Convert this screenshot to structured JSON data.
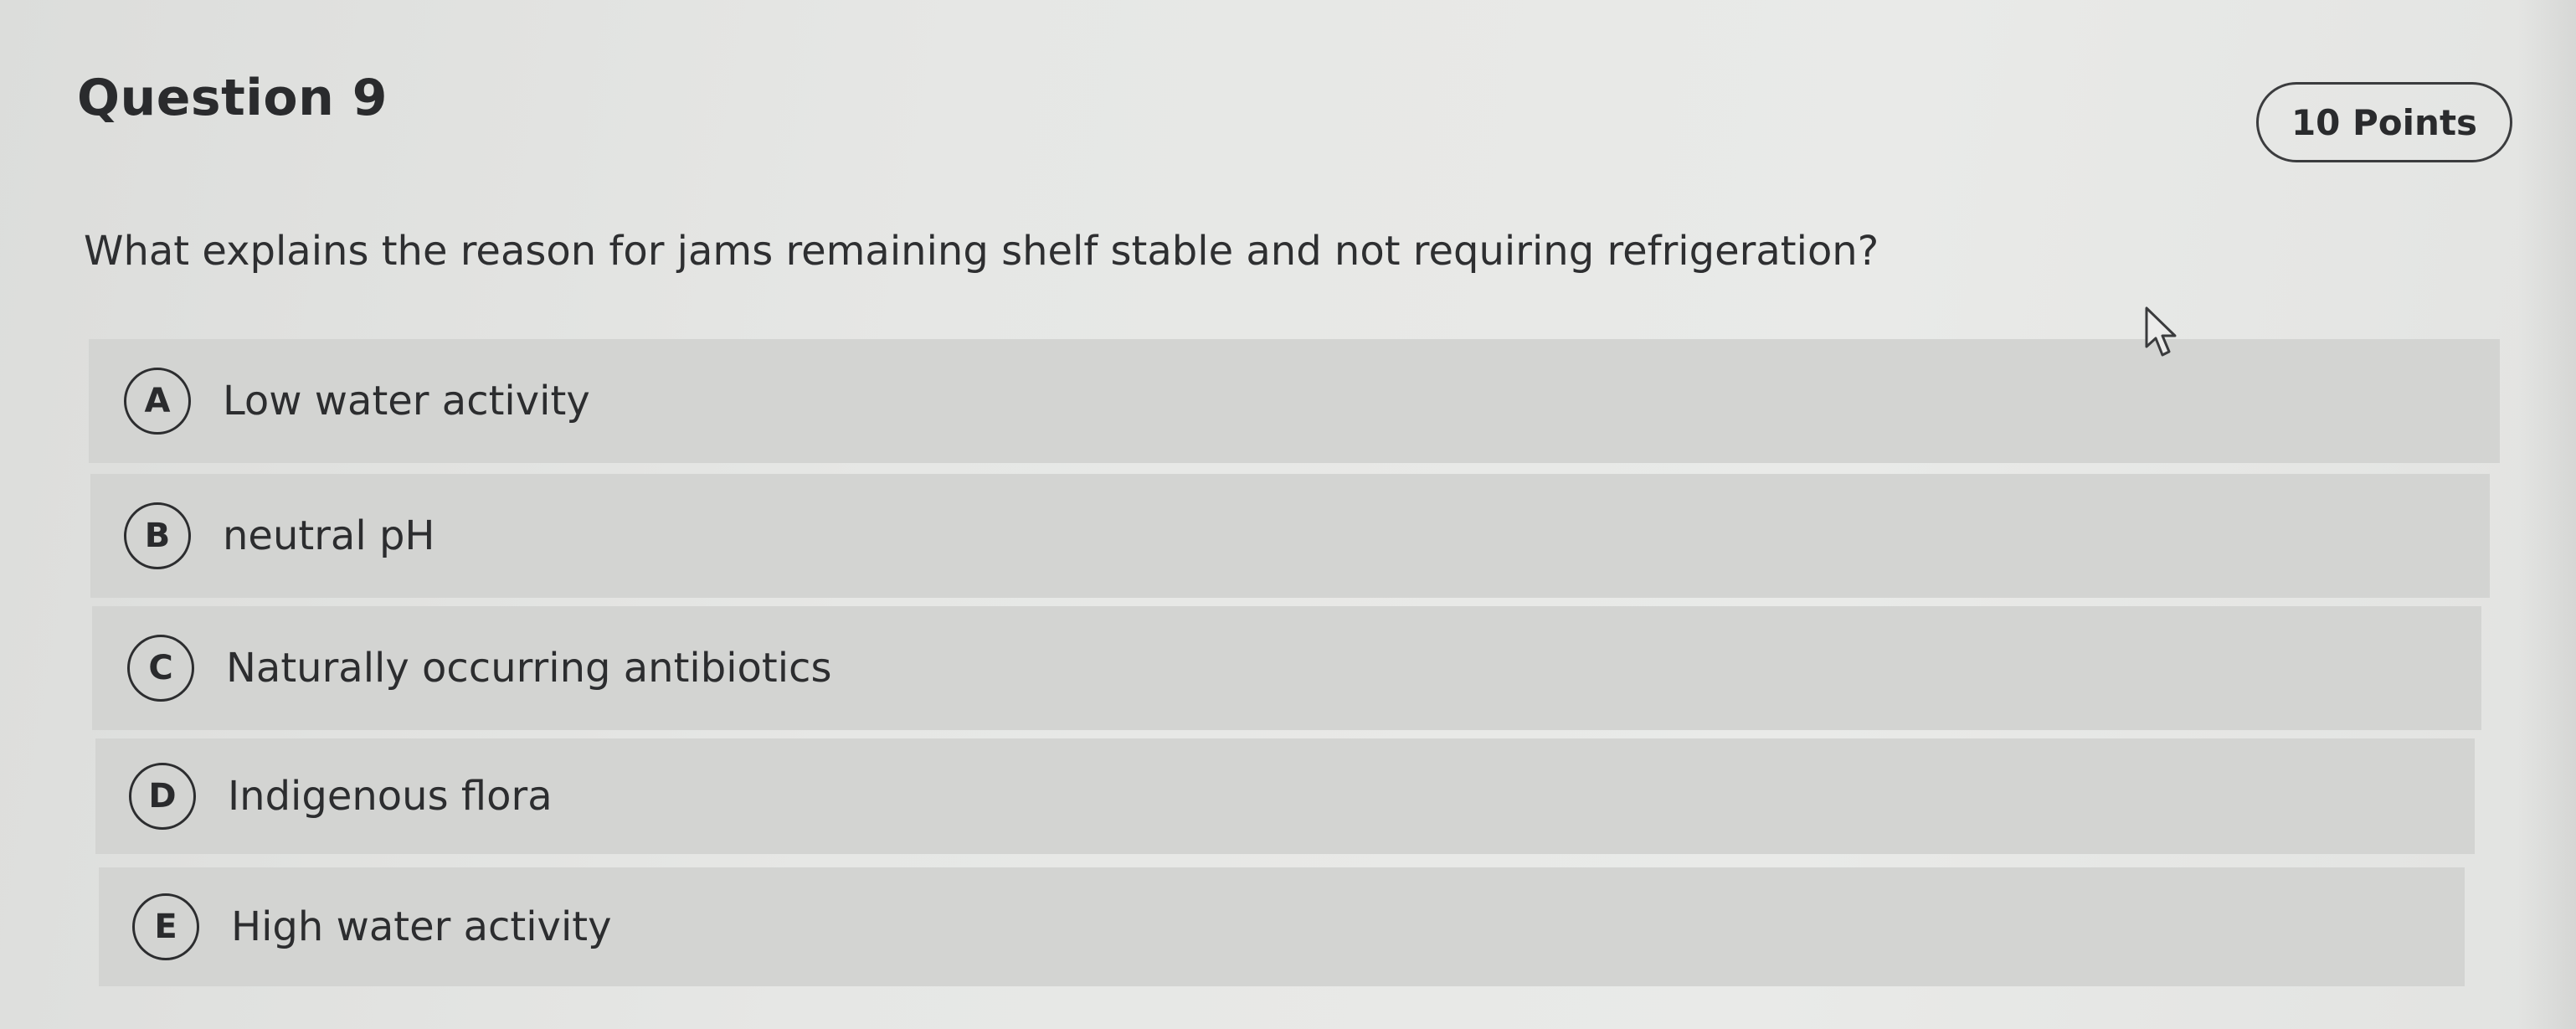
{
  "question": {
    "title": "Question 9",
    "points": "10 Points",
    "prompt": "What explains the reason for jams remaining shelf stable and not requiring refrigeration?"
  },
  "choices": [
    {
      "letter": "A",
      "label": "Low water activity"
    },
    {
      "letter": "B",
      "label": "neutral pH"
    },
    {
      "letter": "C",
      "label": "Naturally occurring antibiotics"
    },
    {
      "letter": "D",
      "label": "Indigenous flora"
    },
    {
      "letter": "E",
      "label": "High water activity"
    }
  ],
  "icons": {
    "cursor": "mouse-pointer-icon"
  },
  "colors": {
    "background": "#e4e5e3",
    "choice_background": "#d3d4d2",
    "text": "#2c2d2f"
  }
}
